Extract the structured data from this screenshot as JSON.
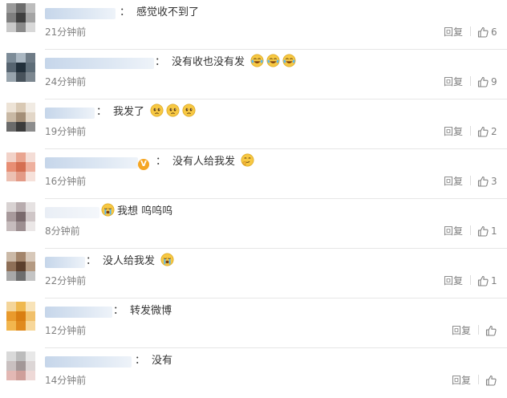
{
  "comments": [
    {
      "text": "感觉收不到了",
      "time": "21分钟前",
      "reply": "回复",
      "likes": "6",
      "emojis": []
    },
    {
      "text": "没有收也没有发",
      "time": "24分钟前",
      "reply": "回复",
      "likes": "9",
      "emojis": [
        "laugh-cry-emoji",
        "laugh-cry-emoji",
        "laugh-cry-emoji"
      ]
    },
    {
      "text": "我发了",
      "time": "19分钟前",
      "reply": "回复",
      "likes": "2",
      "emojis": [
        "worried-emoji",
        "worried-emoji",
        "worried-emoji"
      ]
    },
    {
      "text": "没有人给我发",
      "time": "16分钟前",
      "reply": "回复",
      "likes": "3",
      "verified": "V",
      "emojis": [
        "think-emoji"
      ]
    },
    {
      "text": "我想 呜呜呜",
      "time": "8分钟前",
      "reply": "回复",
      "likes": "1",
      "emojis_before": [
        "crying-emoji"
      ]
    },
    {
      "text": "没人给我发",
      "time": "22分钟前",
      "reply": "回复",
      "likes": "1",
      "emojis": [
        "crying-emoji"
      ]
    },
    {
      "text": "转发微博",
      "time": "12分钟前",
      "reply": "回复",
      "likes": "",
      "emojis": []
    },
    {
      "text": "没有",
      "time": "14分钟前",
      "reply": "回复",
      "likes": "",
      "emojis": []
    }
  ],
  "colon": "：",
  "icons": {
    "like": "thumbs-up-icon"
  },
  "colors": {
    "text": "#333333",
    "meta": "#808080",
    "separator": "#e6e6e6",
    "name_blur": "#c6d6ea",
    "verified": "#f5a623"
  }
}
